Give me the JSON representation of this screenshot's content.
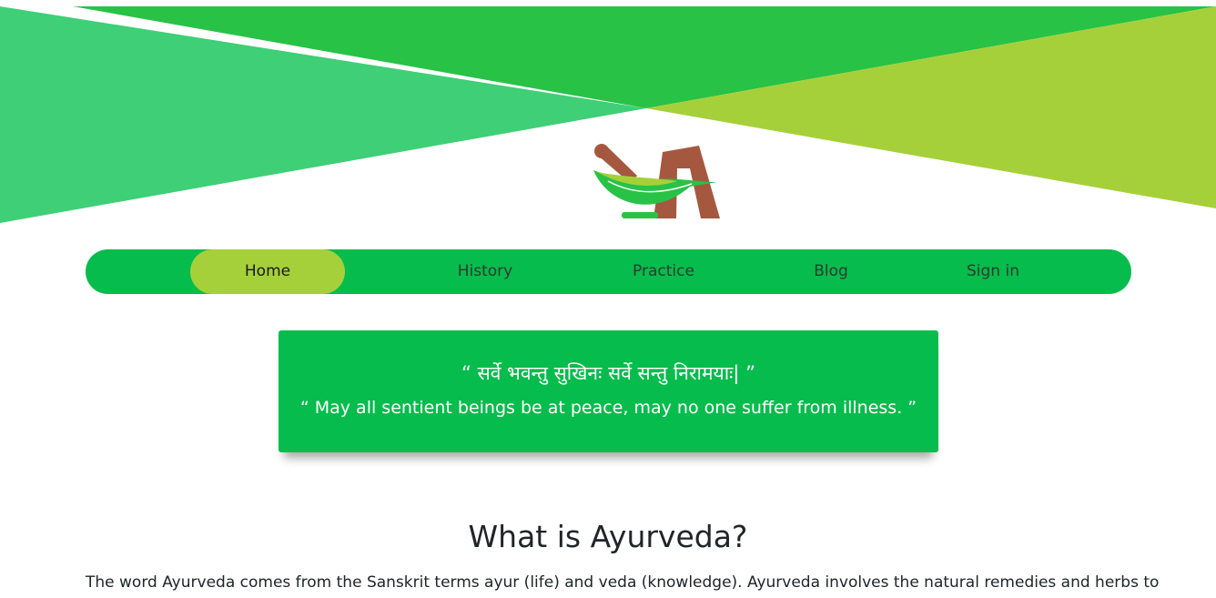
{
  "brand": {
    "logo_icon": "mortar-pestle-leaf-logo-icon"
  },
  "colors": {
    "banner_left": "#3fcf76",
    "banner_top": "#28c247",
    "banner_right": "#a6d03a",
    "nav_background": "#05bc4c",
    "nav_active": "#a6d03a",
    "quote_background": "#05bc4c",
    "logo_brown": "#a5583f"
  },
  "nav": {
    "items": [
      {
        "label": "Home",
        "active": true
      },
      {
        "label": "History",
        "active": false
      },
      {
        "label": "Practice",
        "active": false
      },
      {
        "label": "Blog",
        "active": false
      },
      {
        "label": "Sign in",
        "active": false
      }
    ]
  },
  "quote": {
    "sanskrit": "“ सर्वे भवन्तु सुखिनः सर्वे सन्तु निरामयाः| ”",
    "english": "“ May all sentient beings be at peace, may no one suffer from illness. ”"
  },
  "main": {
    "heading": "What is Ayurveda?",
    "paragraph": "The word Ayurveda comes from the Sanskrit terms ayur (life) and veda (knowledge). Ayurveda involves the natural remedies and herbs to"
  }
}
